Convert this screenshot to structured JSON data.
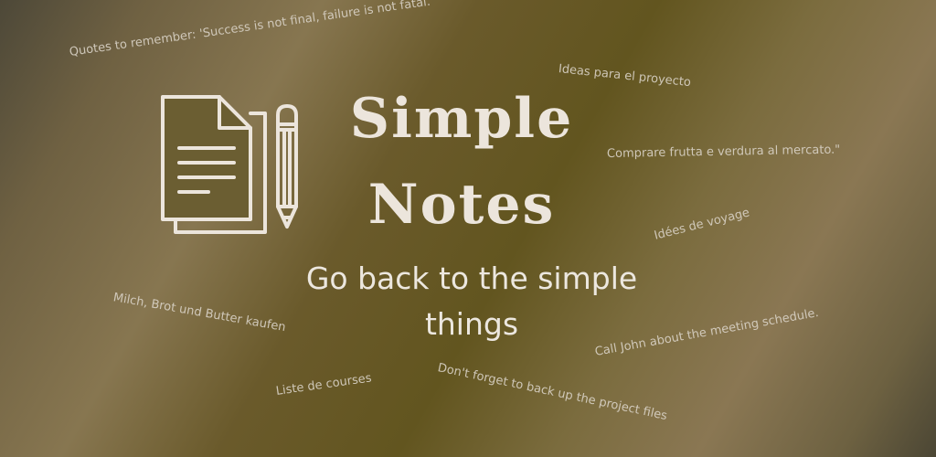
{
  "app": {
    "title_line1": "Simple",
    "title_line2": "Notes",
    "tagline": "Go back to the simple things"
  },
  "floating_notes": [
    "Quotes to remember: 'Success is not final, failure is not fatal.",
    "Ideas para el proyecto",
    "Comprare frutta e verdura al mercato.\"",
    "Idées de voyage",
    "Milch, Brot und Butter kaufen",
    "Call John about the meeting schedule.",
    "Don't forget to back up the project files",
    "Liste de courses"
  ],
  "icons": {
    "logo": "notes-and-pencil-icon"
  },
  "colors": {
    "text_light": "#ece5dc",
    "background_olive": "#62551f",
    "background_tan": "#877650"
  }
}
